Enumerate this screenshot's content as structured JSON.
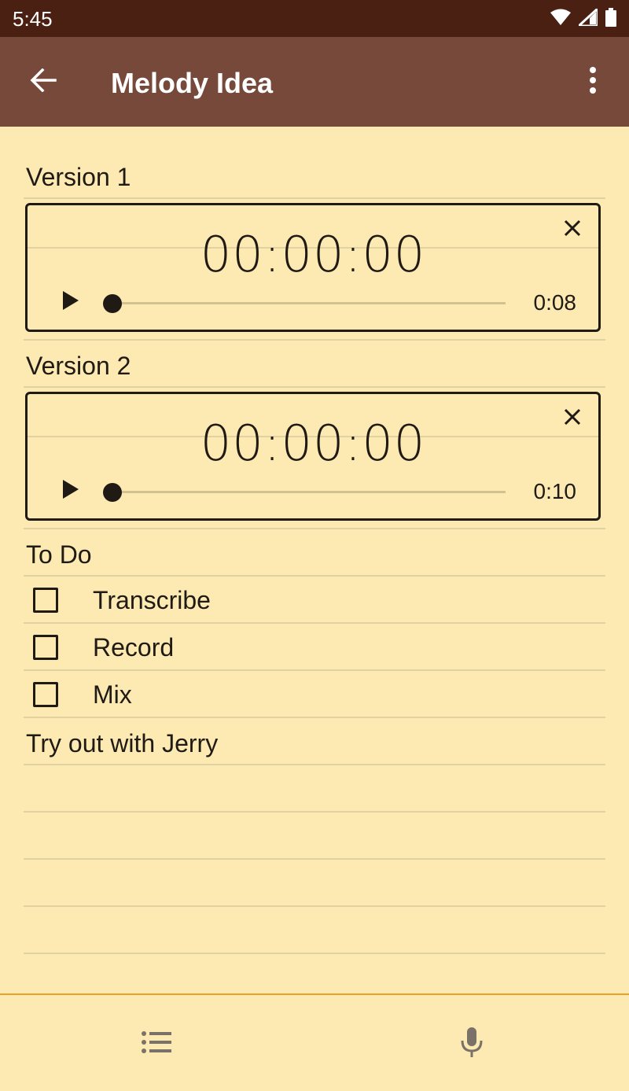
{
  "status_bar": {
    "time": "5:45",
    "icons": [
      "wifi-icon",
      "signal-icon",
      "battery-icon"
    ]
  },
  "app_bar": {
    "title": "Melody Idea",
    "back_icon": "arrow-back-icon",
    "menu_icon": "more-vert-icon"
  },
  "sections": [
    {
      "label": "Version 1",
      "player": {
        "time": "00:00:00",
        "duration": "0:08",
        "progress": 0
      }
    },
    {
      "label": "Version 2",
      "player": {
        "time": "00:00:00",
        "duration": "0:10",
        "progress": 0
      }
    }
  ],
  "todo": {
    "label": "To Do",
    "items": [
      {
        "label": "Transcribe",
        "checked": false
      },
      {
        "label": "Record",
        "checked": false
      },
      {
        "label": "Mix",
        "checked": false
      }
    ]
  },
  "note_text": "Try out with Jerry",
  "bottom_bar": {
    "left_icon": "list-icon",
    "right_icon": "microphone-icon"
  },
  "colors": {
    "status_bar": "#4a2013",
    "app_bar": "#77493a",
    "paper": "#fde9b2",
    "rule": "#e1d2a4",
    "accent_line": "#f0a02a"
  }
}
